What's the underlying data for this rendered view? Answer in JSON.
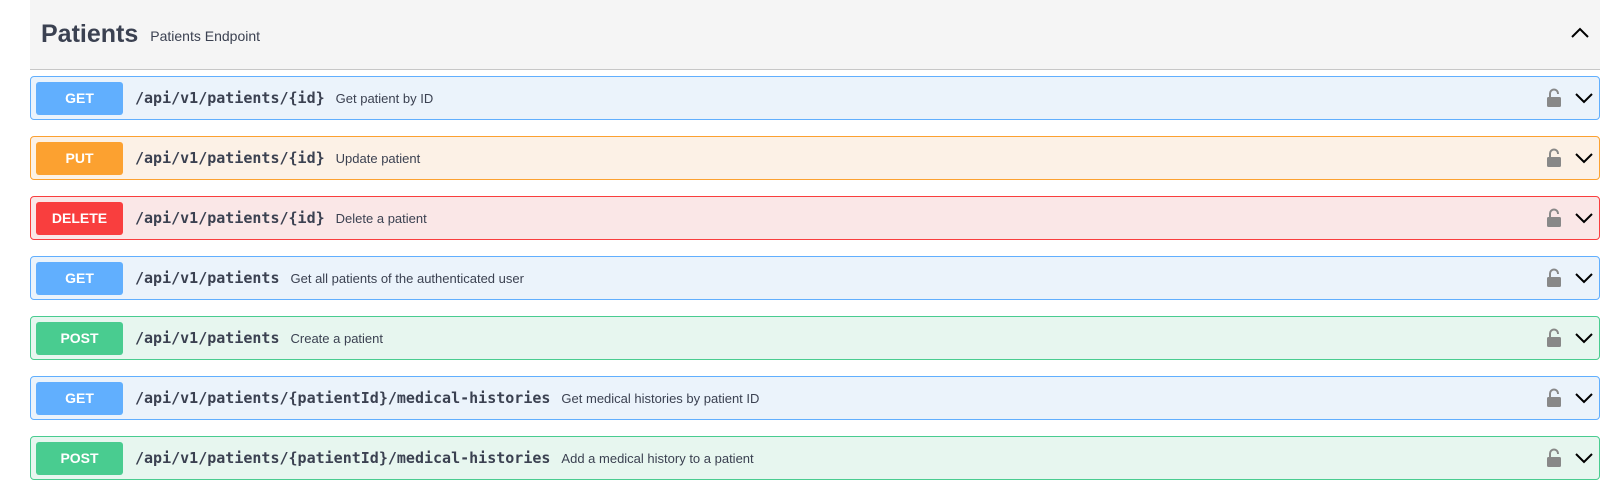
{
  "tag": {
    "title": "Patients",
    "description": "Patients Endpoint"
  },
  "icons": {
    "collapse": "chevron-up-icon",
    "lock": "lock-icon",
    "expand": "chevron-down-icon"
  },
  "colors": {
    "get": "#61affe",
    "put": "#fca130",
    "delete": "#f93e3e",
    "post": "#49cc90"
  },
  "operations": [
    {
      "method": "GET",
      "path": "/api/v1/patients/{id}",
      "summary": "Get patient by ID"
    },
    {
      "method": "PUT",
      "path": "/api/v1/patients/{id}",
      "summary": "Update patient"
    },
    {
      "method": "DELETE",
      "path": "/api/v1/patients/{id}",
      "summary": "Delete a patient"
    },
    {
      "method": "GET",
      "path": "/api/v1/patients",
      "summary": "Get all patients of the authenticated user"
    },
    {
      "method": "POST",
      "path": "/api/v1/patients",
      "summary": "Create a patient"
    },
    {
      "method": "GET",
      "path": "/api/v1/patients/{patientId}/medical-histories",
      "summary": "Get medical histories by patient ID"
    },
    {
      "method": "POST",
      "path": "/api/v1/patients/{patientId}/medical-histories",
      "summary": "Add a medical history to a patient"
    }
  ]
}
